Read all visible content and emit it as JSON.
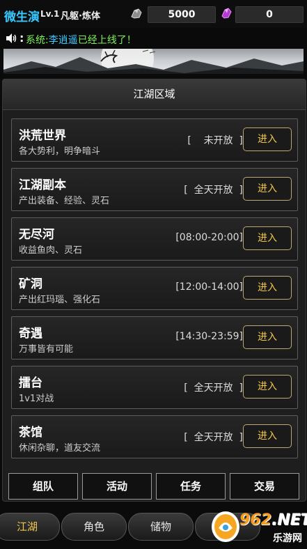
{
  "player": {
    "name": "微生演",
    "level": "Lv.1",
    "realm": "凡躯·炼体",
    "silver": "5000",
    "crystal": "0"
  },
  "announcement": {
    "prefix": "系统:",
    "player": "李逍遥",
    "message": "已经上线了！"
  },
  "panel": {
    "title": "江湖区域",
    "enter_label": "进入",
    "regions": [
      {
        "name": "洪荒世界",
        "desc": "各大势利，明争暗斗",
        "status": "[    未开放  ]"
      },
      {
        "name": "江湖副本",
        "desc": "产出装备、经验、灵石",
        "status": "[  全天开放  ]"
      },
      {
        "name": "无尽河",
        "desc": "收益鱼肉、灵石",
        "status": "[08:00-20:00]"
      },
      {
        "name": "矿洞",
        "desc": "产出红玛瑙、强化石",
        "status": "[12:00-14:00]"
      },
      {
        "name": "奇遇",
        "desc": "万事皆有可能",
        "status": "[14:30-23:59]"
      },
      {
        "name": "擂台",
        "desc": "1v1对战",
        "status": "[  全天开放  ]"
      },
      {
        "name": "茶馆",
        "desc": "休闲杂聊，道友交流",
        "status": "[  全天开放  ]"
      }
    ]
  },
  "actions": [
    "组队",
    "活动",
    "任务",
    "交易"
  ],
  "nav": [
    "江湖",
    "角色",
    "储物",
    "门"
  ],
  "watermark": {
    "brand": "962",
    "suffix": ".NET",
    "sub": "乐游网"
  },
  "colors": {
    "accent_gold": "#f3c84a",
    "name_blue": "#38c8ff",
    "system_green": "#7ef05a"
  }
}
